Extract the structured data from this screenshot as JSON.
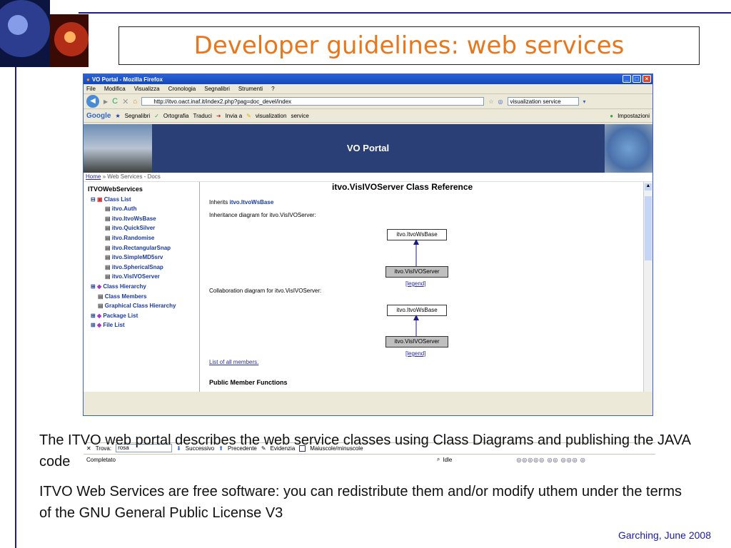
{
  "slide": {
    "title": "Developer guidelines: web services",
    "para1": "The ITVO web portal  describes the web service classes using Class Diagrams and publishing the JAVA code",
    "para2": "ITVO Web Services are free software: you can redistribute them and/or modify uthem under the terms of the GNU General Public License V3",
    "footer": "Garching, June 2008"
  },
  "browser": {
    "window_title": "VO Portal - Mozilla Firefox",
    "menu": [
      "File",
      "Modifica",
      "Visualizza",
      "Cronologia",
      "Segnalibri",
      "Strumenti",
      "?"
    ],
    "url": "http://itvo.oact.inaf.it/index2.php?pag=doc_devel/index",
    "search_value": "visualization service",
    "google_bar": {
      "logo": "Google",
      "bookmarks": "Segnalibri",
      "spell": "Ortografia",
      "translate": "Traduci",
      "send": "Invia a",
      "term1": "visualization",
      "term2": "service",
      "settings": "Impostazioni"
    },
    "banner_title": "VO Portal",
    "breadcrumb": {
      "home": "Home",
      "rest": "» Web Services - Docs"
    },
    "tree": {
      "root": "ITVOWebServices",
      "class_list": "Class List",
      "classes": [
        "itvo.Auth",
        "itvo.ItvoWsBase",
        "itvo.QuickSilver",
        "itvo.Randomise",
        "itvo.RectangularSnap",
        "itvo.SimpleMD5srv",
        "itvo.SphericalSnap",
        "itvo.VisIVOServer"
      ],
      "others": [
        "Class Hierarchy",
        "Class Members",
        "Graphical Class Hierarchy",
        "Package List",
        "File List"
      ]
    },
    "doc": {
      "heading": "itvo.VisIVOServer Class Reference",
      "inherits_prefix": "Inherits",
      "inherits_link": "itvo.ItvoWsBase",
      "inheritance_label": "Inheritance diagram for itvo.VisIVOServer:",
      "collab_label": "Collaboration diagram for itvo.VisIVOServer:",
      "base_box": "itvo.ItvoWsBase",
      "derived_box": "itvo.VisIVOServer",
      "legend": "[legend]",
      "members_link": "List of all members.",
      "section": "Public Member Functions"
    },
    "find": {
      "label": "Trova:",
      "value": "rosa",
      "next": "Successivo",
      "prev": "Precedente",
      "highlight": "Evidenzia",
      "case": "Maiuscole/minuscole"
    },
    "status": {
      "left": "Completato",
      "right": "Idle"
    }
  }
}
